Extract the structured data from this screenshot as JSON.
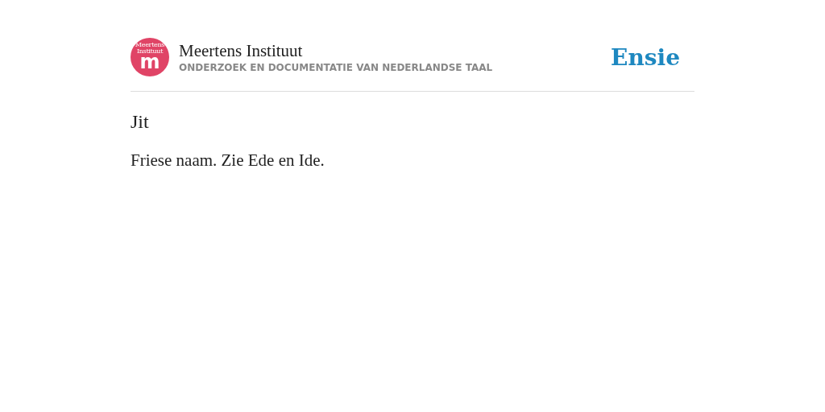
{
  "header": {
    "logo_text": "Meertens Instituut",
    "logo_letter": "m",
    "title": "Meertens Instituut",
    "subtitle": "ONDERZOEK EN DOCUMENTATIE VAN NEDERLANDSE TAAL",
    "brand": "Ensie"
  },
  "entry": {
    "term": "Jit",
    "definition": "Friese naam. Zie Ede en Ide."
  }
}
